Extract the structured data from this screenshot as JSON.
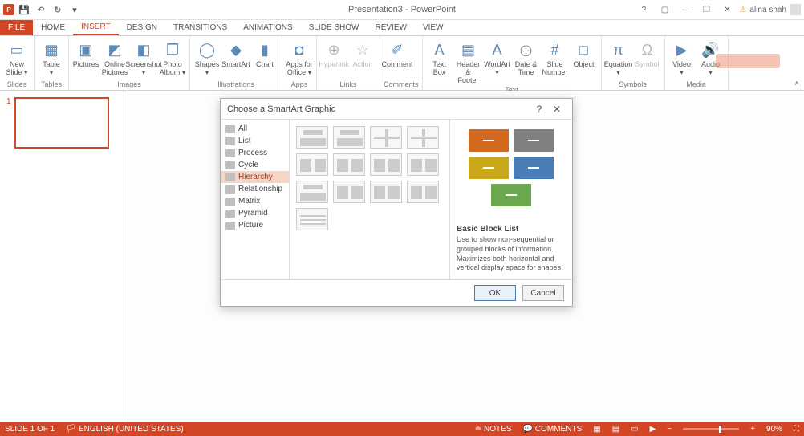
{
  "app": {
    "title": "Presentation3 - PowerPoint",
    "user": "alina shah"
  },
  "tabs": [
    "FILE",
    "HOME",
    "INSERT",
    "DESIGN",
    "TRANSITIONS",
    "ANIMATIONS",
    "SLIDE SHOW",
    "REVIEW",
    "VIEW"
  ],
  "active_tab": "INSERT",
  "ribbon": {
    "groups": [
      {
        "label": "Slides",
        "items": [
          {
            "name": "new-slide",
            "label": "New\nSlide ▾",
            "glyph": "▭"
          }
        ]
      },
      {
        "label": "Tables",
        "items": [
          {
            "name": "table",
            "label": "Table\n▾",
            "glyph": "▦"
          }
        ]
      },
      {
        "label": "Images",
        "items": [
          {
            "name": "pictures",
            "label": "Pictures",
            "glyph": "▣"
          },
          {
            "name": "online-pictures",
            "label": "Online\nPictures",
            "glyph": "◩"
          },
          {
            "name": "screenshot",
            "label": "Screenshot\n▾",
            "glyph": "◧"
          },
          {
            "name": "photo-album",
            "label": "Photo\nAlbum ▾",
            "glyph": "❐"
          }
        ]
      },
      {
        "label": "Illustrations",
        "items": [
          {
            "name": "shapes",
            "label": "Shapes\n▾",
            "glyph": "◯"
          },
          {
            "name": "smartart",
            "label": "SmartArt",
            "glyph": "◆"
          },
          {
            "name": "chart",
            "label": "Chart",
            "glyph": "▮"
          }
        ]
      },
      {
        "label": "Apps",
        "items": [
          {
            "name": "apps-for-office",
            "label": "Apps for\nOffice ▾",
            "glyph": "◘"
          }
        ]
      },
      {
        "label": "Links",
        "items": [
          {
            "name": "hyperlink",
            "label": "Hyperlink",
            "glyph": "⊕",
            "disabled": true
          },
          {
            "name": "action",
            "label": "Action",
            "glyph": "☆",
            "disabled": true
          }
        ]
      },
      {
        "label": "Comments",
        "items": [
          {
            "name": "comment",
            "label": "Comment",
            "glyph": "✐"
          }
        ]
      },
      {
        "label": "Text",
        "items": [
          {
            "name": "text-box",
            "label": "Text\nBox",
            "glyph": "A"
          },
          {
            "name": "header-footer",
            "label": "Header\n& Footer",
            "glyph": "▤"
          },
          {
            "name": "wordart",
            "label": "WordArt\n▾",
            "glyph": "A"
          },
          {
            "name": "date-time",
            "label": "Date &\nTime",
            "glyph": "◷"
          },
          {
            "name": "slide-number",
            "label": "Slide\nNumber",
            "glyph": "#"
          },
          {
            "name": "object",
            "label": "Object",
            "glyph": "□"
          }
        ]
      },
      {
        "label": "Symbols",
        "items": [
          {
            "name": "equation",
            "label": "Equation\n▾",
            "glyph": "π"
          },
          {
            "name": "symbol",
            "label": "Symbol",
            "glyph": "Ω",
            "disabled": true
          }
        ]
      },
      {
        "label": "Media",
        "items": [
          {
            "name": "video",
            "label": "Video\n▾",
            "glyph": "▶"
          },
          {
            "name": "audio",
            "label": "Audio\n▾",
            "glyph": "🔊"
          }
        ]
      }
    ]
  },
  "thumb": {
    "num": "1"
  },
  "dialog": {
    "title": "Choose a SmartArt Graphic",
    "categories": [
      "All",
      "List",
      "Process",
      "Cycle",
      "Hierarchy",
      "Relationship",
      "Matrix",
      "Pyramid",
      "Picture"
    ],
    "selected_category": "Hierarchy",
    "preview": {
      "name": "Basic Block List",
      "desc": "Use to show non-sequential or grouped blocks of information. Maximizes both horizontal and vertical display space for shapes.",
      "blocks": [
        "#d2691e",
        "#808080",
        "#c9a81c",
        "#4a7db8",
        "#6aa84f"
      ]
    },
    "ok": "OK",
    "cancel": "Cancel"
  },
  "status": {
    "slide": "SLIDE 1 OF 1",
    "lang": "ENGLISH (UNITED STATES)",
    "notes": "NOTES",
    "comments": "COMMENTS",
    "zoom": "90%"
  }
}
